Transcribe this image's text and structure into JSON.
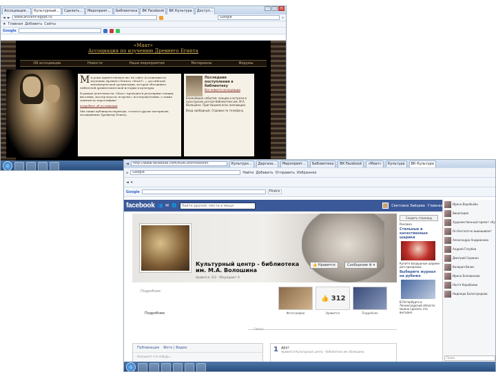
{
  "window1": {
    "tabs": [
      "Ассоциация...",
      "Культурный...",
      "Сделать...",
      "Мероприят...",
      "Библиотека",
      "ВК Facebook",
      "ВК Культура",
      "Доступ..."
    ],
    "address_value": "www.ancient-egypt.ru",
    "search_value": "Google",
    "links": [
      "Главная",
      "Добавить",
      "Сайты"
    ],
    "site_title_line1": "«Маат»",
    "site_title_line2": "Ассоциация по изучению Древнего Египта",
    "nav": [
      "Об ассоциации",
      "Новости",
      "Наши мероприятия",
      "Материалы",
      "Форумы"
    ],
    "main_text": [
      "ы рады приветствовать вас на сайте Ассоциации по изучению Древнего Египта «МААТ» — российской некоммерческой организации, которая объединяет любителей древнеегипетской истории и культуры.",
      "В рамках деятельности «Маат» проводятся регулярные лекции, выставки, мастер-классы, встречи с исследователями, а также занятия по иероглифике.",
      "Мы также публикуем переводы, статьи и другие материалы, посвящённые Древнему Египту."
    ],
    "main_link": "подробнее об ассоциации",
    "side_title": "Последние поступления в библиотеку",
    "side_link": "Все новости ассоциации",
    "side_text": "Ближайшие события: лекции и встречи в культурном центре-библиотеке им. М.А. Волошина. Приглашаем всех желающих.",
    "side_text2": "Вход свободный. Справки по телефону."
  },
  "window2": {
    "address_value": "http://www.facebook.com/KultCentrVoloshin",
    "tabs": [
      "Культурн...",
      "Даргаза...",
      "Мероприят...",
      "Библиотека",
      "ВК Facebook",
      "«Маат»",
      "Культура",
      "ВК Культура"
    ],
    "search_value": "Google",
    "links": [
      "Найти",
      "Добавить",
      "Отправить",
      "Избранное"
    ],
    "google_bar_value": "Поиск",
    "fb_logo": "facebook",
    "fb_search_placeholder": "Найти друзей, места и вещи",
    "fb_user_name": "Светлана Зайцева",
    "fb_home": "Главная",
    "page_name_line1": "Культурный центр - библиотека",
    "page_name_line2": "им. М.А. Волошина",
    "page_meta": "Нравится: 312 · Обсуждают: 6",
    "like_button": "Нравится",
    "message_button": "Сообщение",
    "about_label": "Подробнее",
    "about_value": "Подробнее",
    "app_labels": [
      "Фотографии",
      "Нравится",
      "Подробнее"
    ],
    "likes_count": "312",
    "timeline_label": "Сейчас",
    "post_tab1": "Публикация",
    "post_tab2": "Фото | Видео",
    "post_hint": "Напишите что-нибудь...",
    "post_num": "1",
    "post_title": "друг",
    "post_text": "Нравится Культурный центр - библиотека им. Волошина",
    "ad_button": "Создать страницу",
    "ad_header": "Реклама",
    "ad1_title": "Стильные и качественные шарики",
    "ad1_text": "Купите воздушные шарики для праздника.",
    "ad2_title": "Выберите журнал на рубеже",
    "ad2_text": "В Петербурге и Ленинградской области можно сделать это выгодно.",
    "chat": [
      "Ирина Воробьёва",
      "Википедия",
      "Художественный проект «Культурный рынок»",
      "Он бесплатно вывешивает",
      "Александра Андрианова",
      "Андрей Голубев",
      "Дмитрий Сорокин",
      "Валерия Вилис",
      "Ирина Белевинова",
      "Настя Карабаева",
      "Надежда Белогородова"
    ],
    "chat_search": "Поиск"
  }
}
